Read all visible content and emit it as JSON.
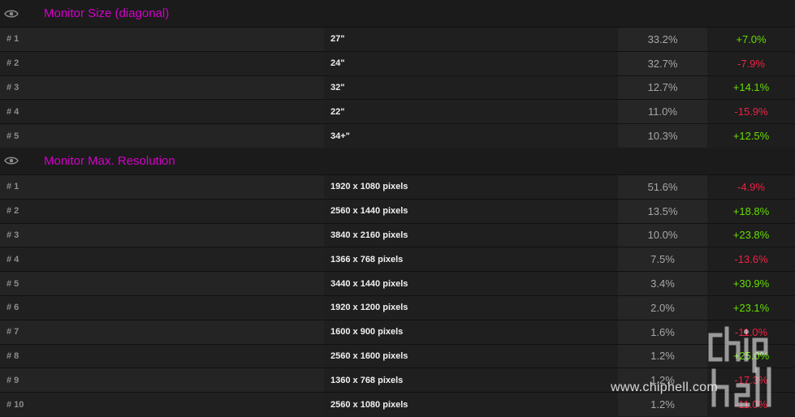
{
  "sections": [
    {
      "title": "Monitor Size (diagonal)",
      "rows": [
        {
          "rank": "# 1",
          "name": "27\"",
          "pct": "33.2%",
          "change": "+7.0%",
          "dir": "up"
        },
        {
          "rank": "# 2",
          "name": "24\"",
          "pct": "32.7%",
          "change": "-7.9%",
          "dir": "down"
        },
        {
          "rank": "# 3",
          "name": "32\"",
          "pct": "12.7%",
          "change": "+14.1%",
          "dir": "up"
        },
        {
          "rank": "# 4",
          "name": "22\"",
          "pct": "11.0%",
          "change": "-15.9%",
          "dir": "down"
        },
        {
          "rank": "# 5",
          "name": "34+\"",
          "pct": "10.3%",
          "change": "+12.5%",
          "dir": "up"
        }
      ]
    },
    {
      "title": "Monitor Max. Resolution",
      "rows": [
        {
          "rank": "# 1",
          "name": "1920 x 1080 pixels",
          "pct": "51.6%",
          "change": "-4.9%",
          "dir": "down"
        },
        {
          "rank": "# 2",
          "name": "2560 x 1440 pixels",
          "pct": "13.5%",
          "change": "+18.8%",
          "dir": "up"
        },
        {
          "rank": "# 3",
          "name": "3840 x 2160 pixels",
          "pct": "10.0%",
          "change": "+23.8%",
          "dir": "up"
        },
        {
          "rank": "# 4",
          "name": "1366 x 768 pixels",
          "pct": "7.5%",
          "change": "-13.6%",
          "dir": "down"
        },
        {
          "rank": "# 5",
          "name": "3440 x 1440 pixels",
          "pct": "3.4%",
          "change": "+30.9%",
          "dir": "up"
        },
        {
          "rank": "# 6",
          "name": "1920 x 1200 pixels",
          "pct": "2.0%",
          "change": "+23.1%",
          "dir": "up"
        },
        {
          "rank": "# 7",
          "name": "1600 x 900 pixels",
          "pct": "1.6%",
          "change": "-11.0%",
          "dir": "down"
        },
        {
          "rank": "# 8",
          "name": "2560 x 1600 pixels",
          "pct": "1.2%",
          "change": "+25.0%",
          "dir": "up"
        },
        {
          "rank": "# 9",
          "name": "1360 x 768 pixels",
          "pct": "1.2%",
          "change": "-17.3%",
          "dir": "down"
        },
        {
          "rank": "# 10",
          "name": "2560 x 1080 pixels",
          "pct": "1.2%",
          "change": "-11.0%",
          "dir": "down"
        }
      ]
    }
  ],
  "watermark": {
    "text": "www.chiphell.com"
  },
  "colors": {
    "title": "#d400c9",
    "up": "#66dd00",
    "down": "#ee2244"
  }
}
